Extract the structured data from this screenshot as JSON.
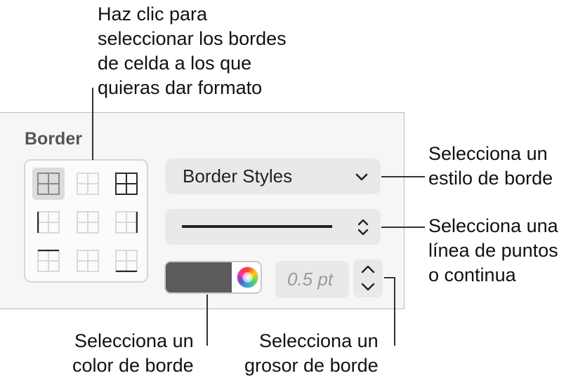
{
  "callouts": {
    "select_borders": "Haz clic para\nseleccionar los bordes\nde celda a los que\nquieras dar formato",
    "border_style": "Selecciona un\nestilo de borde",
    "line_type": "Selecciona una\nlínea de puntos\no continua",
    "border_color": "Selecciona un\ncolor de borde",
    "border_weight": "Selecciona un\ngrosor de borde"
  },
  "panel": {
    "section_label": "Border",
    "border_styles_label": "Border Styles",
    "line_style": "solid",
    "color": "#5b5b5b",
    "weight_value": "0.5 pt"
  },
  "border_grid": {
    "selected_index": 0,
    "cells": [
      {
        "icon": "all-borders-icon"
      },
      {
        "icon": "inside-borders-icon"
      },
      {
        "icon": "outside-borders-icon"
      },
      {
        "icon": "left-border-icon"
      },
      {
        "icon": "inside-vertical-border-icon"
      },
      {
        "icon": "right-border-icon"
      },
      {
        "icon": "top-border-icon"
      },
      {
        "icon": "inside-horizontal-border-icon"
      },
      {
        "icon": "bottom-border-icon"
      }
    ]
  },
  "colors": {
    "panel_bg": "#f6f6f6",
    "control_bg": "#e9e9e9",
    "selected_cell_bg": "#dcdcdc"
  }
}
